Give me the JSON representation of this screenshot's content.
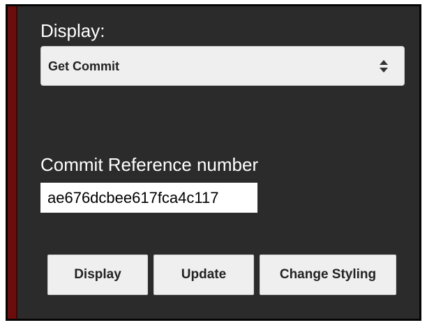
{
  "panel": {
    "display_label": "Display:",
    "display_select": {
      "selected_value": "Get Commit"
    },
    "commit_label": "Commit Reference number",
    "commit_input": {
      "value": "ae676dcbee617fca4c117"
    },
    "buttons": {
      "display": "Display",
      "update": "Update",
      "change_styling": "Change Styling"
    }
  },
  "colors": {
    "panel_background": "#2b2b2b",
    "accent_bar": "#6b0d0d",
    "button_background": "#efefef",
    "text_light": "#ffffff",
    "text_dark": "#222222"
  }
}
